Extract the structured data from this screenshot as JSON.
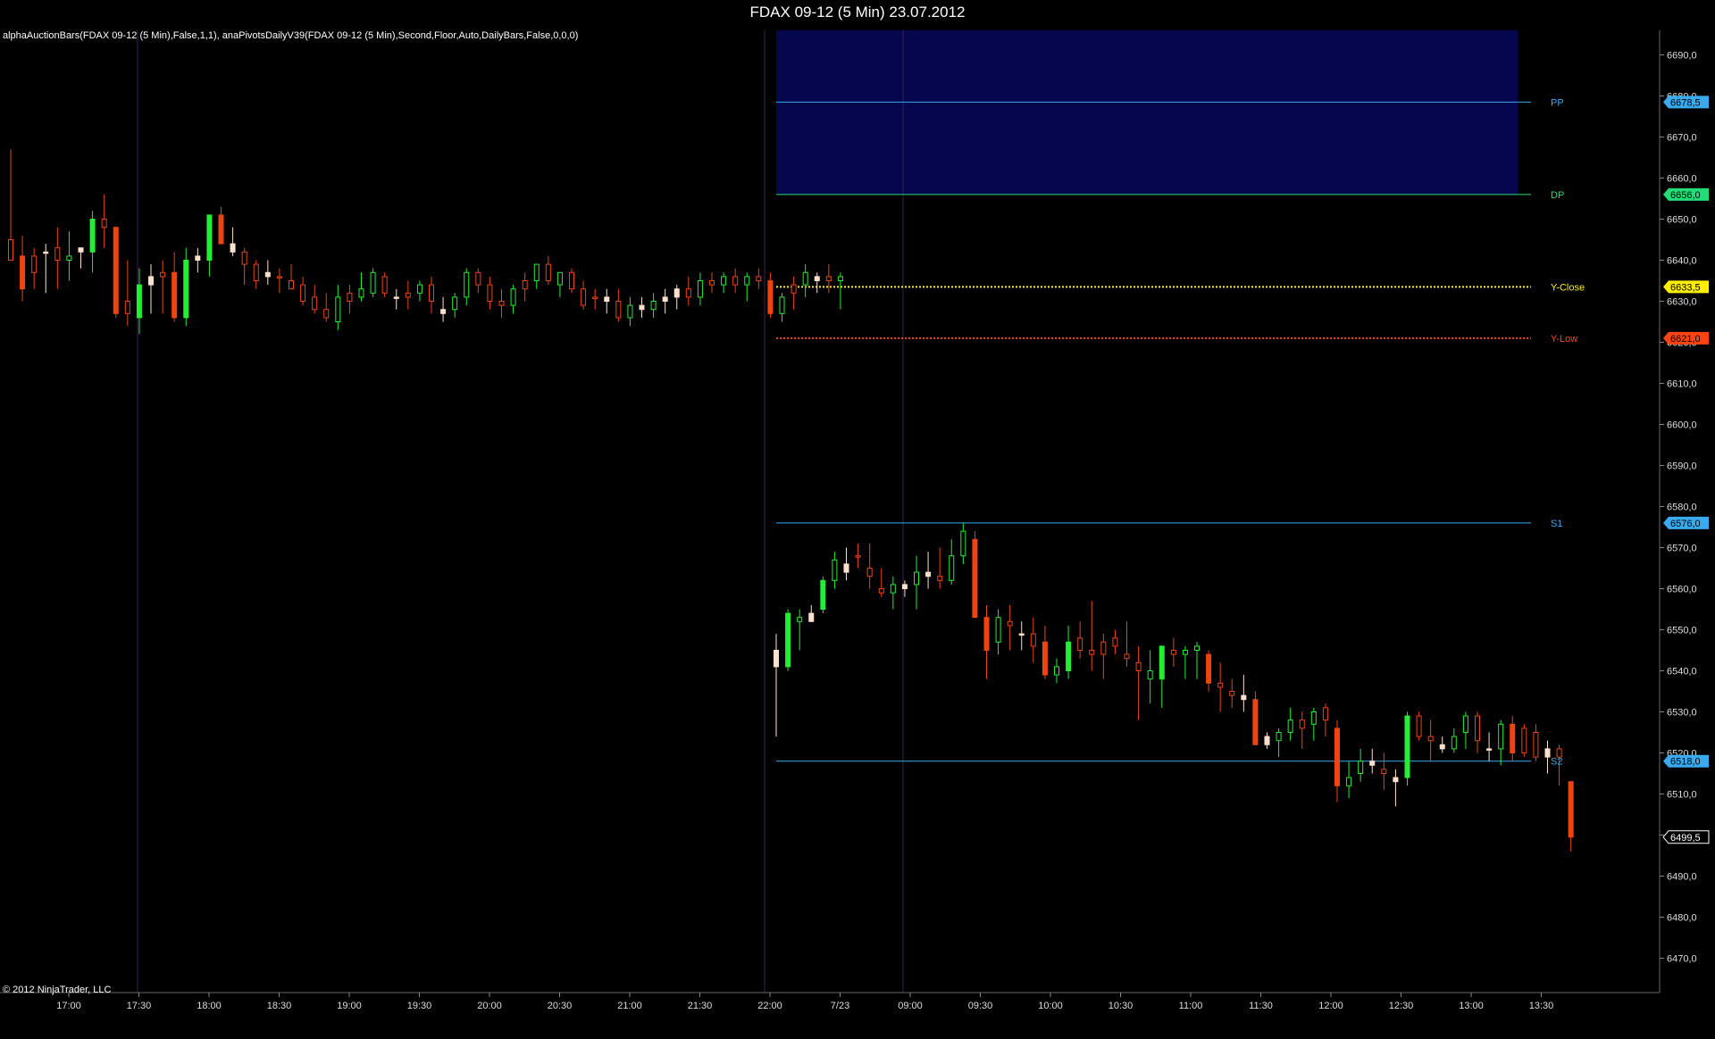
{
  "window": {
    "title": "FDAX 09-12 (5 Min)  23.07.2012"
  },
  "indicator_label": "alphaAuctionBars(FDAX 09-12 (5 Min),False,1,1), anaPivotsDailyV39(FDAX 09-12 (5 Min),Second,Floor,Auto,DailyBars,False,0,0,0)",
  "copyright": "© 2012 NinjaTrader, LLC",
  "colors": {
    "background": "#000000",
    "up": "#22ee33",
    "down": "#ee4411",
    "neutral": "#ffe0cc",
    "band": "#06064e",
    "axis_text": "#dddddd",
    "separator": "#3a1f55"
  },
  "chart_data": {
    "type": "candlestick",
    "ylim": [
      6465,
      6697
    ],
    "y_ticks": [
      6470,
      6480,
      6490,
      6500,
      6510,
      6520,
      6530,
      6540,
      6550,
      6560,
      6570,
      6580,
      6590,
      6600,
      6610,
      6620,
      6630,
      6640,
      6650,
      6660,
      6670,
      6680,
      6690
    ],
    "y_tick_labels": [
      "6470,0",
      "6480,0",
      "6490,0",
      "6500,0",
      "6510,0",
      "6520,0",
      "6530,0",
      "6540,0",
      "6550,0",
      "6560,0",
      "6570,0",
      "6580,0",
      "6590,0",
      "6600,0",
      "6610,0",
      "6620,0",
      "6630,0",
      "6640,0",
      "6650,0",
      "6660,0",
      "6670,0",
      "6680,0",
      "6690,0"
    ],
    "x_tick_labels": [
      "17:00",
      "17:30",
      "18:00",
      "18:30",
      "19:00",
      "19:30",
      "20:00",
      "20:30",
      "21:00",
      "21:30",
      "22:00",
      "7/23",
      "09:00",
      "09:30",
      "10:00",
      "10:30",
      "11:00",
      "11:30",
      "12:00",
      "12:30",
      "13:00",
      "13:30"
    ],
    "last_price_label": "6499,5",
    "band": {
      "from": 6656.0,
      "to": 6697
    },
    "levels": [
      {
        "name": "PP",
        "value": 6678.5,
        "tag": "6678,5",
        "color": "#3aaaee",
        "style": "solid"
      },
      {
        "name": "DP",
        "value": 6656.0,
        "tag": "6656,0",
        "color": "#22dd77",
        "style": "solid"
      },
      {
        "name": "Y-Close",
        "value": 6633.5,
        "tag": "6633,5",
        "color": "#ffee00",
        "style": "dotted"
      },
      {
        "name": "Y-Low",
        "value": 6621.0,
        "tag": "6621,0",
        "color": "#ff4411",
        "style": "dotted"
      },
      {
        "name": "S1",
        "value": 6576.0,
        "tag": "6576,0",
        "color": "#3aaaee",
        "style": "solid"
      },
      {
        "name": "S2",
        "value": 6518.0,
        "tag": "6518,0",
        "color": "#3aaaee",
        "style": "solid"
      }
    ],
    "session1_bars": [
      [
        6645,
        6667,
        6644,
        6640,
        "down"
      ],
      [
        6641,
        6646,
        6630,
        6633,
        "down"
      ],
      [
        6637,
        6643,
        6633,
        6641,
        "down"
      ],
      [
        6642,
        6644,
        6632,
        6642,
        "neutral"
      ],
      [
        6643,
        6648,
        6633,
        6640,
        "down"
      ],
      [
        6640,
        6647,
        6635,
        6641,
        "up"
      ],
      [
        6642,
        6643,
        6638,
        6643,
        "neutral"
      ],
      [
        6642,
        6652,
        6637,
        6650,
        "up"
      ],
      [
        6650,
        6656,
        6643,
        6648,
        "down"
      ],
      [
        6648,
        6648,
        6626,
        6627,
        "down"
      ],
      [
        6630,
        6640,
        6624,
        6627,
        "down"
      ],
      [
        6626,
        6638,
        6622,
        6634,
        "up"
      ],
      [
        6634,
        6639,
        6627,
        6636,
        "neutral"
      ],
      [
        6636,
        6640,
        6627,
        6637,
        "down"
      ],
      [
        6637,
        6642,
        6625,
        6626,
        "down"
      ],
      [
        6626,
        6643,
        6624,
        6640,
        "up"
      ],
      [
        6640,
        6643,
        6637,
        6641,
        "neutral"
      ],
      [
        6640,
        6648,
        6636,
        6651,
        "up"
      ],
      [
        6651,
        6653,
        6645,
        6644,
        "down"
      ],
      [
        6644,
        6648,
        6641,
        6642,
        "neutral"
      ],
      [
        6642,
        6643,
        6634,
        6639,
        "down"
      ],
      [
        6639,
        6640,
        6633,
        6635,
        "down"
      ],
      [
        6636,
        6640,
        6634,
        6637,
        "neutral"
      ],
      [
        6636,
        6638,
        6632,
        6636,
        "down"
      ],
      [
        6635,
        6639,
        6633,
        6633,
        "down"
      ],
      [
        6634,
        6636,
        6629,
        6630,
        "down"
      ],
      [
        6631,
        6634,
        6627,
        6628,
        "down"
      ],
      [
        6628,
        6632,
        6625,
        6626,
        "down"
      ],
      [
        6625,
        6634,
        6623,
        6631,
        "up"
      ],
      [
        6632,
        6634,
        6627,
        6630,
        "down"
      ],
      [
        6631,
        6637,
        6630,
        6633,
        "up"
      ],
      [
        6632,
        6638,
        6631,
        6637,
        "up"
      ],
      [
        6636,
        6637,
        6631,
        6632,
        "down"
      ],
      [
        6631,
        6633,
        6628,
        6631,
        "neutral"
      ],
      [
        6631,
        6635,
        6628,
        6632,
        "down"
      ],
      [
        6632,
        6635,
        6630,
        6634,
        "up"
      ],
      [
        6634,
        6636,
        6627,
        6630,
        "down"
      ],
      [
        6628,
        6631,
        6625,
        6627,
        "neutral"
      ],
      [
        6628,
        6632,
        6626,
        6631,
        "up"
      ],
      [
        6631,
        6638,
        6629,
        6637,
        "up"
      ],
      [
        6637,
        6638,
        6632,
        6634,
        "down"
      ],
      [
        6634,
        6636,
        6628,
        6630,
        "down"
      ],
      [
        6630,
        6633,
        6626,
        6629,
        "down"
      ],
      [
        6629,
        6634,
        6627,
        6633,
        "up"
      ],
      [
        6633,
        6637,
        6630,
        6635,
        "down"
      ],
      [
        6635,
        6639,
        6633,
        6639,
        "up"
      ],
      [
        6639,
        6641,
        6634,
        6635,
        "down"
      ],
      [
        6634,
        6637,
        6631,
        6637,
        "up"
      ],
      [
        6637,
        6638,
        6632,
        6633,
        "down"
      ],
      [
        6633,
        6635,
        6628,
        6629,
        "down"
      ],
      [
        6631,
        6633,
        6628,
        6631,
        "down"
      ],
      [
        6631,
        6633,
        6627,
        6630,
        "neutral"
      ],
      [
        6630,
        6633,
        6625,
        6626,
        "down"
      ],
      [
        6626,
        6631,
        6624,
        6629,
        "up"
      ],
      [
        6629,
        6631,
        6626,
        6628,
        "neutral"
      ],
      [
        6628,
        6632,
        6626,
        6630,
        "up"
      ],
      [
        6630,
        6633,
        6627,
        6631,
        "neutral"
      ],
      [
        6631,
        6634,
        6628,
        6633,
        "neutral"
      ],
      [
        6633,
        6636,
        6629,
        6631,
        "down"
      ],
      [
        6631,
        6637,
        6629,
        6635,
        "up"
      ],
      [
        6635,
        6637,
        6632,
        6634,
        "down"
      ],
      [
        6634,
        6637,
        6632,
        6636,
        "up"
      ],
      [
        6636,
        6638,
        6632,
        6634,
        "down"
      ],
      [
        6634,
        6637,
        6630,
        6636,
        "up"
      ],
      [
        6635,
        6638,
        6633,
        6636,
        "down"
      ],
      [
        6635,
        6637,
        6626,
        6627,
        "down"
      ],
      [
        6627,
        6632,
        6625,
        6631,
        "up"
      ],
      [
        6632,
        6636,
        6628,
        6634,
        "down"
      ],
      [
        6634,
        6639,
        6631,
        6637,
        "up"
      ],
      [
        6636,
        6637,
        6632,
        6635,
        "neutral"
      ],
      [
        6635,
        6639,
        6632,
        6636,
        "down"
      ],
      [
        6635,
        6637,
        6628,
        6636,
        "up"
      ]
    ],
    "session2_bars": [
      [
        6545,
        6549,
        6524,
        6541,
        "neutral"
      ],
      [
        6541,
        6555,
        6540,
        6554,
        "up"
      ],
      [
        6553,
        6555,
        6545,
        6552,
        "up"
      ],
      [
        6552,
        6556,
        6552,
        6554,
        "neutral"
      ],
      [
        6555,
        6563,
        6554,
        6562,
        "up"
      ],
      [
        6562,
        6569,
        6560,
        6567,
        "up"
      ],
      [
        6564,
        6570,
        6562,
        6566,
        "neutral"
      ],
      [
        6568,
        6571,
        6565,
        6568,
        "down"
      ],
      [
        6565,
        6571,
        6560,
        6563,
        "down"
      ],
      [
        6560,
        6565,
        6558,
        6559,
        "down"
      ],
      [
        6559,
        6563,
        6555,
        6561,
        "up"
      ],
      [
        6560,
        6562,
        6558,
        6561,
        "neutral"
      ],
      [
        6561,
        6568,
        6555,
        6564,
        "up"
      ],
      [
        6564,
        6569,
        6560,
        6563,
        "neutral"
      ],
      [
        6562,
        6570,
        6560,
        6563,
        "down"
      ],
      [
        6562,
        6572,
        6561,
        6568,
        "up"
      ],
      [
        6568,
        6576,
        6566,
        6574,
        "up"
      ],
      [
        6572,
        6574,
        6553,
        6553,
        "down"
      ],
      [
        6553,
        6556,
        6538,
        6545,
        "down"
      ],
      [
        6547,
        6555,
        6544,
        6553,
        "up"
      ],
      [
        6552,
        6556,
        6545,
        6551,
        "down"
      ],
      [
        6549,
        6552,
        6545,
        6549,
        "neutral"
      ],
      [
        6549,
        6553,
        6542,
        6546,
        "down"
      ],
      [
        6547,
        6551,
        6538,
        6539,
        "down"
      ],
      [
        6539,
        6543,
        6537,
        6541,
        "up"
      ],
      [
        6540,
        6551,
        6538,
        6547,
        "up"
      ],
      [
        6548,
        6552,
        6543,
        6545,
        "down"
      ],
      [
        6544,
        6557,
        6540,
        6545,
        "down"
      ],
      [
        6544,
        6549,
        6538,
        6547,
        "down"
      ],
      [
        6548,
        6550,
        6544,
        6546,
        "down"
      ],
      [
        6544,
        6552,
        6541,
        6543,
        "down"
      ],
      [
        6542,
        6546,
        6528,
        6540,
        "down"
      ],
      [
        6540,
        6545,
        6532,
        6538,
        "up"
      ],
      [
        6538,
        6546,
        6531,
        6546,
        "up"
      ],
      [
        6545,
        6548,
        6541,
        6544,
        "down"
      ],
      [
        6544,
        6546,
        6538,
        6545,
        "up"
      ],
      [
        6546,
        6547,
        6538,
        6545,
        "up"
      ],
      [
        6544,
        6545,
        6535,
        6537,
        "down"
      ],
      [
        6537,
        6542,
        6530,
        6536,
        "down"
      ],
      [
        6535,
        6538,
        6531,
        6534,
        "down"
      ],
      [
        6534,
        6539,
        6530,
        6533,
        "neutral"
      ],
      [
        6533,
        6535,
        6522,
        6522,
        "down"
      ],
      [
        6522,
        6525,
        6521,
        6524,
        "neutral"
      ],
      [
        6523,
        6526,
        6519,
        6525,
        "up"
      ],
      [
        6525,
        6531,
        6523,
        6528,
        "up"
      ],
      [
        6528,
        6530,
        6521,
        6526,
        "down"
      ],
      [
        6527,
        6531,
        6523,
        6530,
        "up"
      ],
      [
        6531,
        6532,
        6524,
        6528,
        "down"
      ],
      [
        6526,
        6528,
        6508,
        6512,
        "down"
      ],
      [
        6512,
        6518,
        6509,
        6514,
        "up"
      ],
      [
        6515,
        6521,
        6513,
        6518,
        "up"
      ],
      [
        6518,
        6521,
        6515,
        6517,
        "neutral"
      ],
      [
        6516,
        6520,
        6511,
        6515,
        "down"
      ],
      [
        6514,
        6516,
        6507,
        6513,
        "neutral"
      ],
      [
        6514,
        6530,
        6512,
        6529,
        "up"
      ],
      [
        6529,
        6530,
        6523,
        6524,
        "down"
      ],
      [
        6524,
        6528,
        6518,
        6523,
        "down"
      ],
      [
        6522,
        6524,
        6520,
        6521,
        "neutral"
      ],
      [
        6521,
        6526,
        6520,
        6524,
        "up"
      ],
      [
        6525,
        6530,
        6521,
        6529,
        "up"
      ],
      [
        6529,
        6530,
        6520,
        6523,
        "down"
      ],
      [
        6521,
        6525,
        6518,
        6521,
        "neutral"
      ],
      [
        6521,
        6528,
        6517,
        6527,
        "up"
      ],
      [
        6527,
        6529,
        6518,
        6520,
        "down"
      ],
      [
        6520,
        6527,
        6519,
        6526,
        "down"
      ],
      [
        6525,
        6527,
        6518,
        6519,
        "down"
      ],
      [
        6519,
        6523,
        6515,
        6521,
        "neutral"
      ],
      [
        6521,
        6522,
        6512,
        6519,
        "down"
      ],
      [
        6513,
        6513,
        6496,
        6499.5,
        "down"
      ]
    ]
  }
}
